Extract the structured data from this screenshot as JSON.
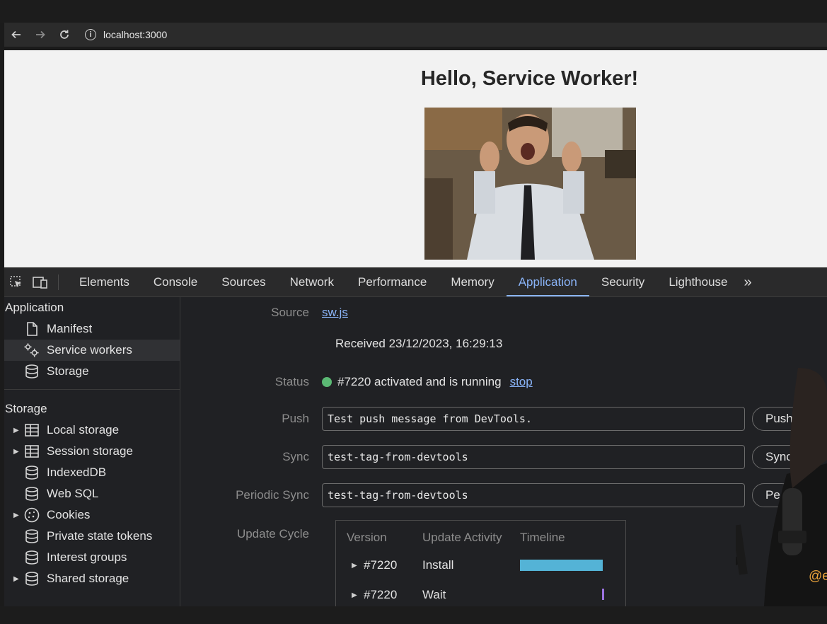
{
  "browser": {
    "url": "localhost:3000"
  },
  "page": {
    "heading": "Hello, Service Worker!"
  },
  "devtools": {
    "tabs": [
      {
        "label": "Elements"
      },
      {
        "label": "Console"
      },
      {
        "label": "Sources"
      },
      {
        "label": "Network"
      },
      {
        "label": "Performance"
      },
      {
        "label": "Memory"
      },
      {
        "label": "Application",
        "active": true
      },
      {
        "label": "Security"
      },
      {
        "label": "Lighthouse"
      }
    ],
    "more_icon": "chevron-double-right-icon",
    "accent_color": "#8ab4f8"
  },
  "sidebar": {
    "application_header": "Application",
    "application_items": [
      {
        "label": "Manifest",
        "icon": "document-icon"
      },
      {
        "label": "Service workers",
        "icon": "gears-icon",
        "active": true
      },
      {
        "label": "Storage",
        "icon": "database-icon"
      }
    ],
    "storage_header": "Storage",
    "storage_items": [
      {
        "label": "Local storage",
        "icon": "table-icon",
        "expandable": true
      },
      {
        "label": "Session storage",
        "icon": "table-icon",
        "expandable": true
      },
      {
        "label": "IndexedDB",
        "icon": "database-icon"
      },
      {
        "label": "Web SQL",
        "icon": "database-icon"
      },
      {
        "label": "Cookies",
        "icon": "cookie-icon",
        "expandable": true
      },
      {
        "label": "Private state tokens",
        "icon": "database-icon"
      },
      {
        "label": "Interest groups",
        "icon": "database-icon"
      },
      {
        "label": "Shared storage",
        "icon": "database-icon",
        "expandable": true
      }
    ]
  },
  "service_worker": {
    "source_label": "Source",
    "source_file": "sw.js",
    "received": "Received 23/12/2023, 16:29:13",
    "status_label": "Status",
    "status_text": "#7220 activated and is running",
    "status_color": "#5bb974",
    "stop_link": "stop",
    "push_label": "Push",
    "push_value": "Test push message from DevTools.",
    "push_button": "Push",
    "sync_label": "Sync",
    "sync_value": "test-tag-from-devtools",
    "sync_button": "Sync",
    "periodic_label": "Periodic Sync",
    "periodic_value": "test-tag-from-devtools",
    "periodic_button": "Pe",
    "update_cycle_label": "Update Cycle",
    "update_cycle": {
      "headers": {
        "version": "Version",
        "activity": "Update Activity",
        "timeline": "Timeline"
      },
      "rows": [
        {
          "version": "#7220",
          "activity": "Install"
        },
        {
          "version": "#7220",
          "activity": "Wait"
        }
      ],
      "timeline_colors": [
        "#54b3d6",
        "#9c72e0"
      ]
    }
  },
  "overlay": {
    "handle_fragment": "@e"
  }
}
